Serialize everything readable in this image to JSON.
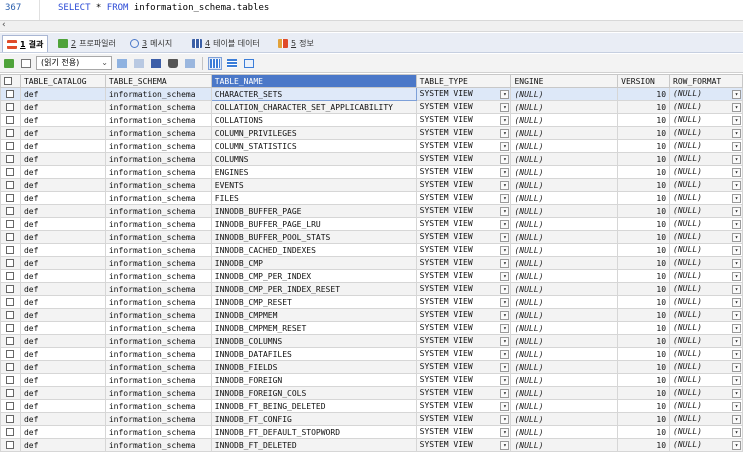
{
  "editor": {
    "line_number": "367",
    "sql_keyword_1": "SELECT",
    "sql_star": " * ",
    "sql_keyword_2": "FROM",
    "sql_rest": " information_schema.tables"
  },
  "tabs": [
    {
      "number": "1",
      "label": "결과",
      "icon": "grid-icon"
    },
    {
      "number": "2",
      "label": "프로파일러",
      "icon": "profiler-icon"
    },
    {
      "number": "3",
      "label": "메시지",
      "icon": "info-icon"
    },
    {
      "number": "4",
      "label": "테이블 데이터",
      "icon": "table-icon"
    },
    {
      "number": "5",
      "label": "정보",
      "icon": "info-bars-icon"
    }
  ],
  "toolbar": {
    "mode_select": "(읽기 전용)"
  },
  "grid": {
    "columns": [
      "TABLE_CATALOG",
      "TABLE_SCHEMA",
      "TABLE_NAME",
      "TABLE_TYPE",
      "ENGINE",
      "VERSION",
      "ROW_FORMAT"
    ],
    "selected_column": "TABLE_NAME",
    "rows": [
      [
        "def",
        "information_schema",
        "CHARACTER_SETS",
        "SYSTEM VIEW",
        "(NULL)",
        "10",
        "(NULL)"
      ],
      [
        "def",
        "information_schema",
        "COLLATION_CHARACTER_SET_APPLICABILITY",
        "SYSTEM VIEW",
        "(NULL)",
        "10",
        "(NULL)"
      ],
      [
        "def",
        "information_schema",
        "COLLATIONS",
        "SYSTEM VIEW",
        "(NULL)",
        "10",
        "(NULL)"
      ],
      [
        "def",
        "information_schema",
        "COLUMN_PRIVILEGES",
        "SYSTEM VIEW",
        "(NULL)",
        "10",
        "(NULL)"
      ],
      [
        "def",
        "information_schema",
        "COLUMN_STATISTICS",
        "SYSTEM VIEW",
        "(NULL)",
        "10",
        "(NULL)"
      ],
      [
        "def",
        "information_schema",
        "COLUMNS",
        "SYSTEM VIEW",
        "(NULL)",
        "10",
        "(NULL)"
      ],
      [
        "def",
        "information_schema",
        "ENGINES",
        "SYSTEM VIEW",
        "(NULL)",
        "10",
        "(NULL)"
      ],
      [
        "def",
        "information_schema",
        "EVENTS",
        "SYSTEM VIEW",
        "(NULL)",
        "10",
        "(NULL)"
      ],
      [
        "def",
        "information_schema",
        "FILES",
        "SYSTEM VIEW",
        "(NULL)",
        "10",
        "(NULL)"
      ],
      [
        "def",
        "information_schema",
        "INNODB_BUFFER_PAGE",
        "SYSTEM VIEW",
        "(NULL)",
        "10",
        "(NULL)"
      ],
      [
        "def",
        "information_schema",
        "INNODB_BUFFER_PAGE_LRU",
        "SYSTEM VIEW",
        "(NULL)",
        "10",
        "(NULL)"
      ],
      [
        "def",
        "information_schema",
        "INNODB_BUFFER_POOL_STATS",
        "SYSTEM VIEW",
        "(NULL)",
        "10",
        "(NULL)"
      ],
      [
        "def",
        "information_schema",
        "INNODB_CACHED_INDEXES",
        "SYSTEM VIEW",
        "(NULL)",
        "10",
        "(NULL)"
      ],
      [
        "def",
        "information_schema",
        "INNODB_CMP",
        "SYSTEM VIEW",
        "(NULL)",
        "10",
        "(NULL)"
      ],
      [
        "def",
        "information_schema",
        "INNODB_CMP_PER_INDEX",
        "SYSTEM VIEW",
        "(NULL)",
        "10",
        "(NULL)"
      ],
      [
        "def",
        "information_schema",
        "INNODB_CMP_PER_INDEX_RESET",
        "SYSTEM VIEW",
        "(NULL)",
        "10",
        "(NULL)"
      ],
      [
        "def",
        "information_schema",
        "INNODB_CMP_RESET",
        "SYSTEM VIEW",
        "(NULL)",
        "10",
        "(NULL)"
      ],
      [
        "def",
        "information_schema",
        "INNODB_CMPMEM",
        "SYSTEM VIEW",
        "(NULL)",
        "10",
        "(NULL)"
      ],
      [
        "def",
        "information_schema",
        "INNODB_CMPMEM_RESET",
        "SYSTEM VIEW",
        "(NULL)",
        "10",
        "(NULL)"
      ],
      [
        "def",
        "information_schema",
        "INNODB_COLUMNS",
        "SYSTEM VIEW",
        "(NULL)",
        "10",
        "(NULL)"
      ],
      [
        "def",
        "information_schema",
        "INNODB_DATAFILES",
        "SYSTEM VIEW",
        "(NULL)",
        "10",
        "(NULL)"
      ],
      [
        "def",
        "information_schema",
        "INNODB_FIELDS",
        "SYSTEM VIEW",
        "(NULL)",
        "10",
        "(NULL)"
      ],
      [
        "def",
        "information_schema",
        "INNODB_FOREIGN",
        "SYSTEM VIEW",
        "(NULL)",
        "10",
        "(NULL)"
      ],
      [
        "def",
        "information_schema",
        "INNODB_FOREIGN_COLS",
        "SYSTEM VIEW",
        "(NULL)",
        "10",
        "(NULL)"
      ],
      [
        "def",
        "information_schema",
        "INNODB_FT_BEING_DELETED",
        "SYSTEM VIEW",
        "(NULL)",
        "10",
        "(NULL)"
      ],
      [
        "def",
        "information_schema",
        "INNODB_FT_CONFIG",
        "SYSTEM VIEW",
        "(NULL)",
        "10",
        "(NULL)"
      ],
      [
        "def",
        "information_schema",
        "INNODB_FT_DEFAULT_STOPWORD",
        "SYSTEM VIEW",
        "(NULL)",
        "10",
        "(NULL)"
      ],
      [
        "def",
        "information_schema",
        "INNODB_FT_DELETED",
        "SYSTEM VIEW",
        "(NULL)",
        "10",
        "(NULL)"
      ]
    ]
  },
  "colors": {
    "accent": "#4b78c8",
    "sql_keyword": "#2b4ad6",
    "line_number": "#2b5fad"
  }
}
